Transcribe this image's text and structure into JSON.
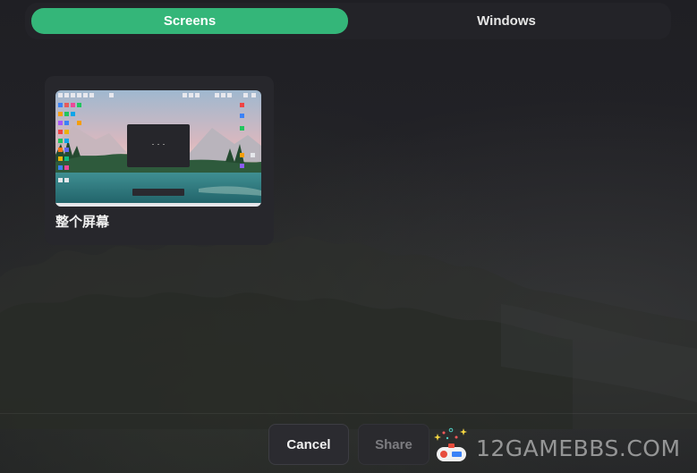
{
  "tabs": [
    {
      "label": "Screens",
      "active": true
    },
    {
      "label": "Windows",
      "active": false
    }
  ],
  "sources": [
    {
      "label": "整个屏幕"
    }
  ],
  "footer": {
    "cancel_label": "Cancel",
    "share_label": "Share",
    "share_enabled": false
  },
  "watermark": {
    "text": "12GAMEBBS.COM",
    "icon": "game-controller-icon"
  },
  "colors": {
    "accent": "#34b679",
    "background": "#1c1c20",
    "card": "#27272c"
  }
}
